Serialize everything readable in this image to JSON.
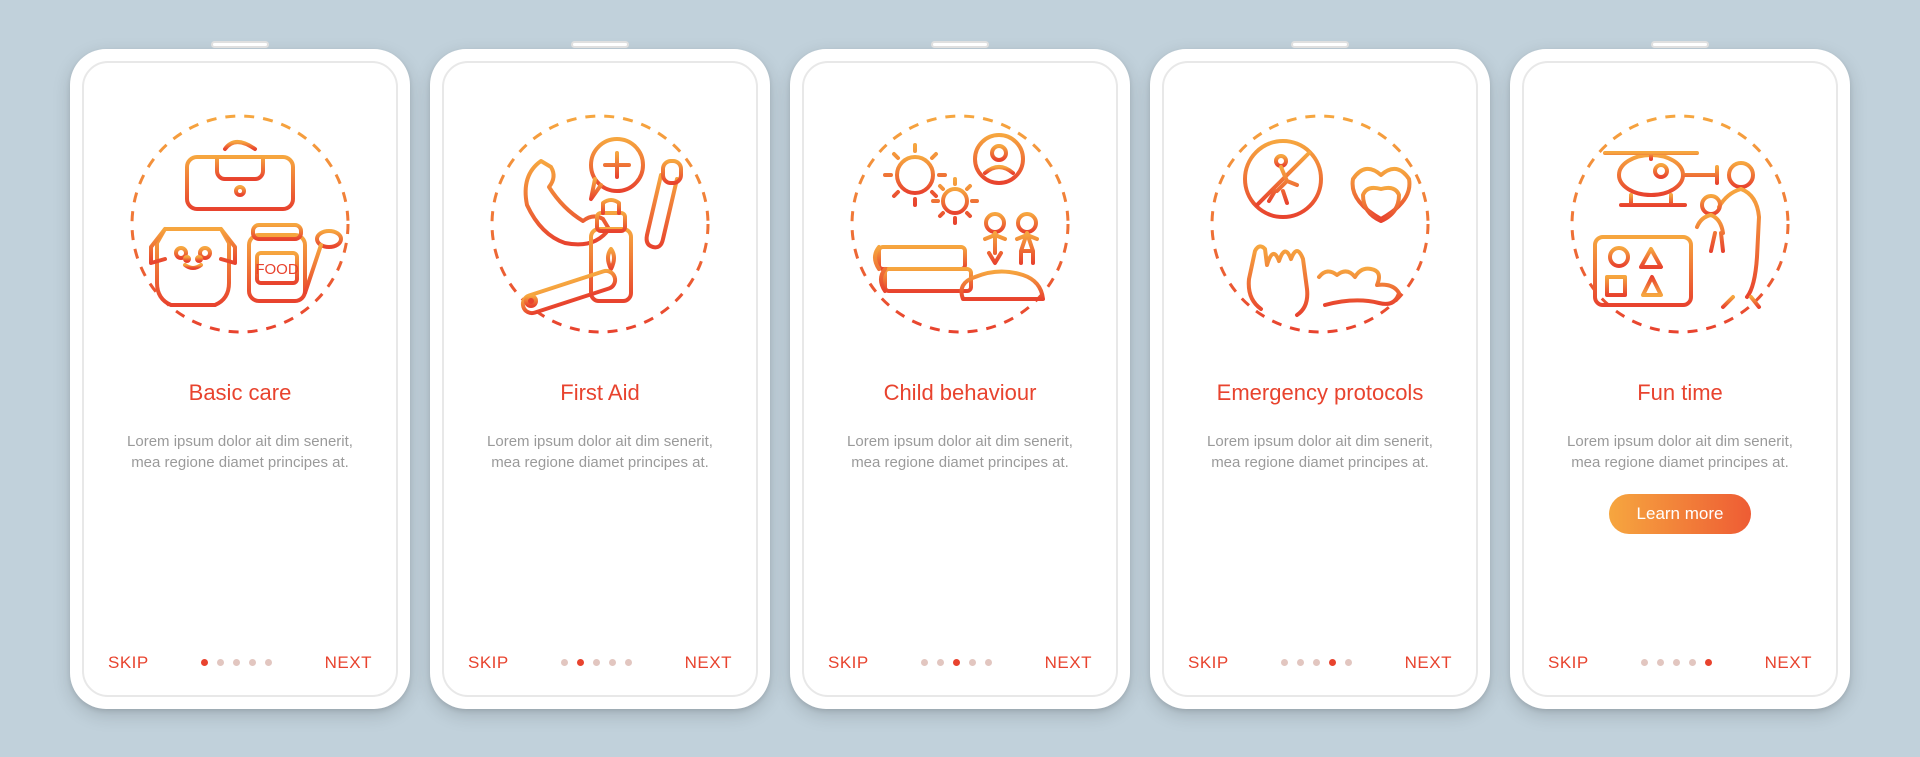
{
  "common": {
    "skip": "SKIP",
    "next": "NEXT",
    "learn_more": "Learn more",
    "lorem": "Lorem ipsum dolor ait dim senerit, mea regione diamet principes at."
  },
  "screens": [
    {
      "title": "Basic care",
      "icon": "basic-care",
      "active_dot": 0,
      "learn_more": false
    },
    {
      "title": "First Aid",
      "icon": "first-aid",
      "active_dot": 1,
      "learn_more": false
    },
    {
      "title": "Child behaviour",
      "icon": "child-behaviour",
      "active_dot": 2,
      "learn_more": false
    },
    {
      "title": "Emergency protocols",
      "icon": "emergency-protocols",
      "active_dot": 3,
      "learn_more": false
    },
    {
      "title": "Fun time",
      "icon": "fun-time",
      "active_dot": 4,
      "learn_more": true
    }
  ]
}
